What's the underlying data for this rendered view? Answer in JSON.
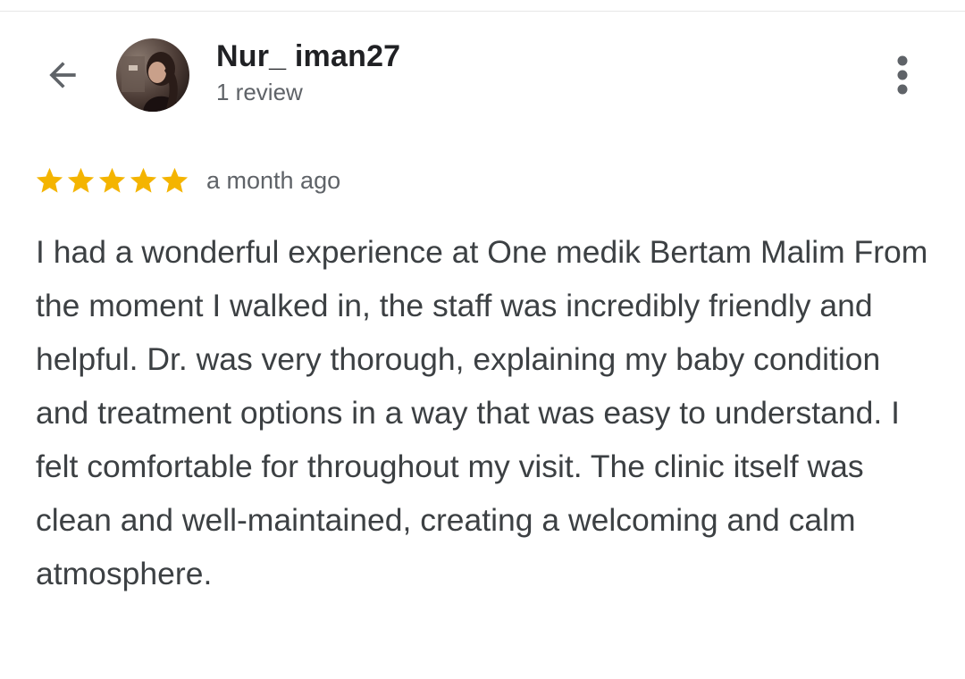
{
  "header": {
    "back_icon": "arrow-left-icon",
    "user_name": "Nur_ iman27",
    "review_count": "1 review",
    "more_icon": "more-vertical-icon"
  },
  "review": {
    "rating": 5,
    "rating_max": 5,
    "time_ago": "a month ago",
    "text": "I had a wonderful experience at One medik Bertam Malim From the moment I walked in, the staff was incredibly friendly and helpful. Dr. was very thorough, explaining my baby condition and treatment options in a way that was easy to understand. I felt comfortable for throughout my visit. The clinic itself was clean and well-maintained, creating a welcoming and calm atmosphere."
  },
  "colors": {
    "star": "#f4b400",
    "name": "#202124",
    "secondary_text": "#5f6368",
    "body_text": "#3c4043",
    "icon": "#5f6368"
  }
}
